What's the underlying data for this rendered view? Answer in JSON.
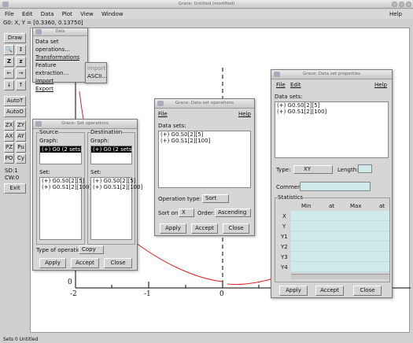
{
  "window": {
    "title": "Grace: Untitled (modified)",
    "help": "Help"
  },
  "menubar": [
    "File",
    "Edit",
    "Data",
    "Plot",
    "View",
    "Window"
  ],
  "statusbar": {
    "coords": "G0: X, Y = [0.3360, 0.13750]",
    "bottom": "Sets  0  Untitled"
  },
  "toolbar": {
    "draw": "Draw",
    "icons": [
      "zoom-icon",
      "zoom-y-icon",
      "zoom-in-icon",
      "zoom-out-icon",
      "pan-left-icon",
      "pan-right-icon",
      "pan-down-icon",
      "pan-up-icon"
    ],
    "buttons": [
      "AutoT",
      "AutoO",
      "ZX",
      "ZY",
      "AX",
      "AY",
      "PZ",
      "Pu",
      "PO",
      "Cy"
    ],
    "sd": "SD:1",
    "cw": "CW:0",
    "exit": "Exit"
  },
  "plot": {
    "xticks": [
      "-2",
      "-1",
      "0"
    ],
    "ytick": "0",
    "curve_color": "#e02020"
  },
  "data_menu": {
    "title": "Data",
    "items": [
      "Data set operations...",
      "Transformations",
      "Feature extraction...",
      "Import",
      "Export"
    ],
    "submenu": [
      "Import",
      "ASCII..."
    ]
  },
  "setops": {
    "title": "Grace: Set operations",
    "source": "Source",
    "destination": "Destination",
    "graph": "Graph:",
    "graph_item_src": "(+) G0 (2 sets)",
    "graph_item_dst": "(+) G0 (2 sets)",
    "set": "Set:",
    "sets": [
      "(+) G0.S0[2][5]",
      "(+) G0.S1[2][100]"
    ],
    "type_label": "Type of operation:",
    "type_value": "Copy",
    "apply": "Apply",
    "accept": "Accept",
    "close": "Close"
  },
  "dsops": {
    "title": "Grace: Data set operations",
    "file": "File",
    "help": "Help",
    "datasets": "Data sets:",
    "sets": [
      "(+) G0.S0[2][5]",
      "(+) G0.S1[2][100]"
    ],
    "optype_label": "Operation type:",
    "optype_value": "Sort",
    "sorton_label": "Sort on:",
    "sorton_value": "X",
    "order_label": "Order:",
    "order_value": "Ascending",
    "apply": "Apply",
    "accept": "Accept",
    "close": "Close"
  },
  "dsprops": {
    "title": "Grace: Data set properties",
    "file": "File",
    "edit": "Edit",
    "help": "Help",
    "datasets": "Data sets:",
    "sets": [
      "(+) G0.S0[2][5]",
      "(+) G0.S1[2][100]"
    ],
    "type_label": "Type:",
    "type_value": "XY",
    "length_label": "Length:",
    "comment_label": "Comment:",
    "stats_title": "Statistics",
    "cols": [
      "Min",
      "at",
      "Max",
      "at"
    ],
    "rows": [
      "X",
      "Y",
      "Y1",
      "Y2",
      "Y3",
      "Y4"
    ],
    "apply": "Apply",
    "accept": "Accept",
    "close": "Close"
  }
}
